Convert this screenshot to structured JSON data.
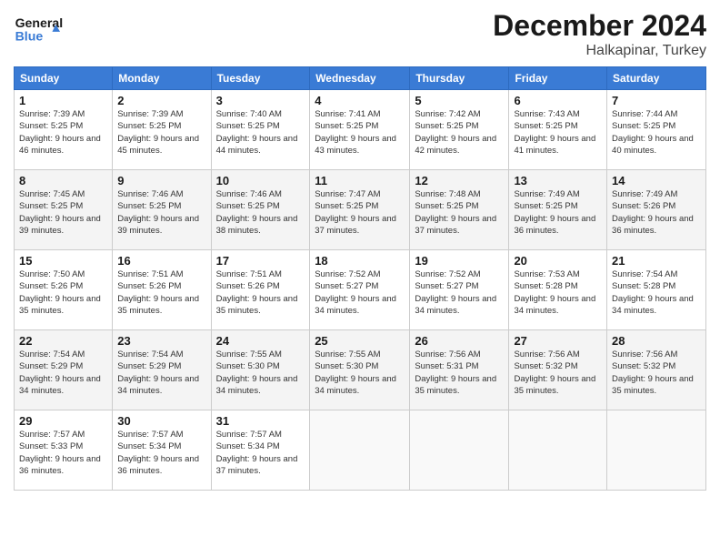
{
  "header": {
    "logo_line1": "General",
    "logo_line2": "Blue",
    "title": "December 2024",
    "subtitle": "Halkapinar, Turkey"
  },
  "weekdays": [
    "Sunday",
    "Monday",
    "Tuesday",
    "Wednesday",
    "Thursday",
    "Friday",
    "Saturday"
  ],
  "weeks": [
    [
      {
        "day": "1",
        "sunrise": "Sunrise: 7:39 AM",
        "sunset": "Sunset: 5:25 PM",
        "daylight": "Daylight: 9 hours and 46 minutes."
      },
      {
        "day": "2",
        "sunrise": "Sunrise: 7:39 AM",
        "sunset": "Sunset: 5:25 PM",
        "daylight": "Daylight: 9 hours and 45 minutes."
      },
      {
        "day": "3",
        "sunrise": "Sunrise: 7:40 AM",
        "sunset": "Sunset: 5:25 PM",
        "daylight": "Daylight: 9 hours and 44 minutes."
      },
      {
        "day": "4",
        "sunrise": "Sunrise: 7:41 AM",
        "sunset": "Sunset: 5:25 PM",
        "daylight": "Daylight: 9 hours and 43 minutes."
      },
      {
        "day": "5",
        "sunrise": "Sunrise: 7:42 AM",
        "sunset": "Sunset: 5:25 PM",
        "daylight": "Daylight: 9 hours and 42 minutes."
      },
      {
        "day": "6",
        "sunrise": "Sunrise: 7:43 AM",
        "sunset": "Sunset: 5:25 PM",
        "daylight": "Daylight: 9 hours and 41 minutes."
      },
      {
        "day": "7",
        "sunrise": "Sunrise: 7:44 AM",
        "sunset": "Sunset: 5:25 PM",
        "daylight": "Daylight: 9 hours and 40 minutes."
      }
    ],
    [
      {
        "day": "8",
        "sunrise": "Sunrise: 7:45 AM",
        "sunset": "Sunset: 5:25 PM",
        "daylight": "Daylight: 9 hours and 39 minutes."
      },
      {
        "day": "9",
        "sunrise": "Sunrise: 7:46 AM",
        "sunset": "Sunset: 5:25 PM",
        "daylight": "Daylight: 9 hours and 39 minutes."
      },
      {
        "day": "10",
        "sunrise": "Sunrise: 7:46 AM",
        "sunset": "Sunset: 5:25 PM",
        "daylight": "Daylight: 9 hours and 38 minutes."
      },
      {
        "day": "11",
        "sunrise": "Sunrise: 7:47 AM",
        "sunset": "Sunset: 5:25 PM",
        "daylight": "Daylight: 9 hours and 37 minutes."
      },
      {
        "day": "12",
        "sunrise": "Sunrise: 7:48 AM",
        "sunset": "Sunset: 5:25 PM",
        "daylight": "Daylight: 9 hours and 37 minutes."
      },
      {
        "day": "13",
        "sunrise": "Sunrise: 7:49 AM",
        "sunset": "Sunset: 5:25 PM",
        "daylight": "Daylight: 9 hours and 36 minutes."
      },
      {
        "day": "14",
        "sunrise": "Sunrise: 7:49 AM",
        "sunset": "Sunset: 5:26 PM",
        "daylight": "Daylight: 9 hours and 36 minutes."
      }
    ],
    [
      {
        "day": "15",
        "sunrise": "Sunrise: 7:50 AM",
        "sunset": "Sunset: 5:26 PM",
        "daylight": "Daylight: 9 hours and 35 minutes."
      },
      {
        "day": "16",
        "sunrise": "Sunrise: 7:51 AM",
        "sunset": "Sunset: 5:26 PM",
        "daylight": "Daylight: 9 hours and 35 minutes."
      },
      {
        "day": "17",
        "sunrise": "Sunrise: 7:51 AM",
        "sunset": "Sunset: 5:26 PM",
        "daylight": "Daylight: 9 hours and 35 minutes."
      },
      {
        "day": "18",
        "sunrise": "Sunrise: 7:52 AM",
        "sunset": "Sunset: 5:27 PM",
        "daylight": "Daylight: 9 hours and 34 minutes."
      },
      {
        "day": "19",
        "sunrise": "Sunrise: 7:52 AM",
        "sunset": "Sunset: 5:27 PM",
        "daylight": "Daylight: 9 hours and 34 minutes."
      },
      {
        "day": "20",
        "sunrise": "Sunrise: 7:53 AM",
        "sunset": "Sunset: 5:28 PM",
        "daylight": "Daylight: 9 hours and 34 minutes."
      },
      {
        "day": "21",
        "sunrise": "Sunrise: 7:54 AM",
        "sunset": "Sunset: 5:28 PM",
        "daylight": "Daylight: 9 hours and 34 minutes."
      }
    ],
    [
      {
        "day": "22",
        "sunrise": "Sunrise: 7:54 AM",
        "sunset": "Sunset: 5:29 PM",
        "daylight": "Daylight: 9 hours and 34 minutes."
      },
      {
        "day": "23",
        "sunrise": "Sunrise: 7:54 AM",
        "sunset": "Sunset: 5:29 PM",
        "daylight": "Daylight: 9 hours and 34 minutes."
      },
      {
        "day": "24",
        "sunrise": "Sunrise: 7:55 AM",
        "sunset": "Sunset: 5:30 PM",
        "daylight": "Daylight: 9 hours and 34 minutes."
      },
      {
        "day": "25",
        "sunrise": "Sunrise: 7:55 AM",
        "sunset": "Sunset: 5:30 PM",
        "daylight": "Daylight: 9 hours and 34 minutes."
      },
      {
        "day": "26",
        "sunrise": "Sunrise: 7:56 AM",
        "sunset": "Sunset: 5:31 PM",
        "daylight": "Daylight: 9 hours and 35 minutes."
      },
      {
        "day": "27",
        "sunrise": "Sunrise: 7:56 AM",
        "sunset": "Sunset: 5:32 PM",
        "daylight": "Daylight: 9 hours and 35 minutes."
      },
      {
        "day": "28",
        "sunrise": "Sunrise: 7:56 AM",
        "sunset": "Sunset: 5:32 PM",
        "daylight": "Daylight: 9 hours and 35 minutes."
      }
    ],
    [
      {
        "day": "29",
        "sunrise": "Sunrise: 7:57 AM",
        "sunset": "Sunset: 5:33 PM",
        "daylight": "Daylight: 9 hours and 36 minutes."
      },
      {
        "day": "30",
        "sunrise": "Sunrise: 7:57 AM",
        "sunset": "Sunset: 5:34 PM",
        "daylight": "Daylight: 9 hours and 36 minutes."
      },
      {
        "day": "31",
        "sunrise": "Sunrise: 7:57 AM",
        "sunset": "Sunset: 5:34 PM",
        "daylight": "Daylight: 9 hours and 37 minutes."
      },
      null,
      null,
      null,
      null
    ]
  ]
}
